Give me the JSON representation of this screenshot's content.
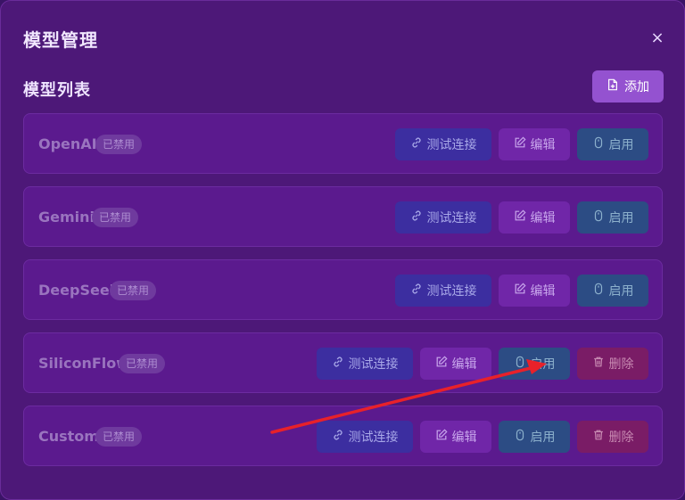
{
  "dialog": {
    "title": "模型管理",
    "close_label": "×"
  },
  "section": {
    "title": "模型列表",
    "add_label": "添加"
  },
  "models": [
    {
      "name": "OpenAI",
      "status": "已禁用",
      "test_label": "测试连接",
      "edit_label": "编辑",
      "enable_label": "启用",
      "delete_label": ""
    },
    {
      "name": "Gemini",
      "status": "已禁用",
      "test_label": "测试连接",
      "edit_label": "编辑",
      "enable_label": "启用",
      "delete_label": ""
    },
    {
      "name": "DeepSeek",
      "status": "已禁用",
      "test_label": "测试连接",
      "edit_label": "编辑",
      "enable_label": "启用",
      "delete_label": ""
    },
    {
      "name": "SiliconFlow",
      "status": "已禁用",
      "test_label": "测试连接",
      "edit_label": "编辑",
      "enable_label": "启用",
      "delete_label": "删除"
    },
    {
      "name": "Custom",
      "status": "已禁用",
      "test_label": "测试连接",
      "edit_label": "编辑",
      "enable_label": "启用",
      "delete_label": "删除"
    }
  ],
  "colors": {
    "dialog_bg": "#4d1878",
    "row_bg": "#5b1a8e",
    "add_button": "#9452d0",
    "test_button": "#3c2ea0",
    "edit_button": "#7026a8",
    "enable_button": "#2c4c84",
    "delete_button": "#7a1c66",
    "annotation_arrow": "#e8212a"
  },
  "icons": {
    "add": "file-plus-icon",
    "test": "link-icon",
    "edit": "pencil-square-icon",
    "enable": "mouse-icon",
    "delete": "trash-icon",
    "close": "close-icon"
  }
}
